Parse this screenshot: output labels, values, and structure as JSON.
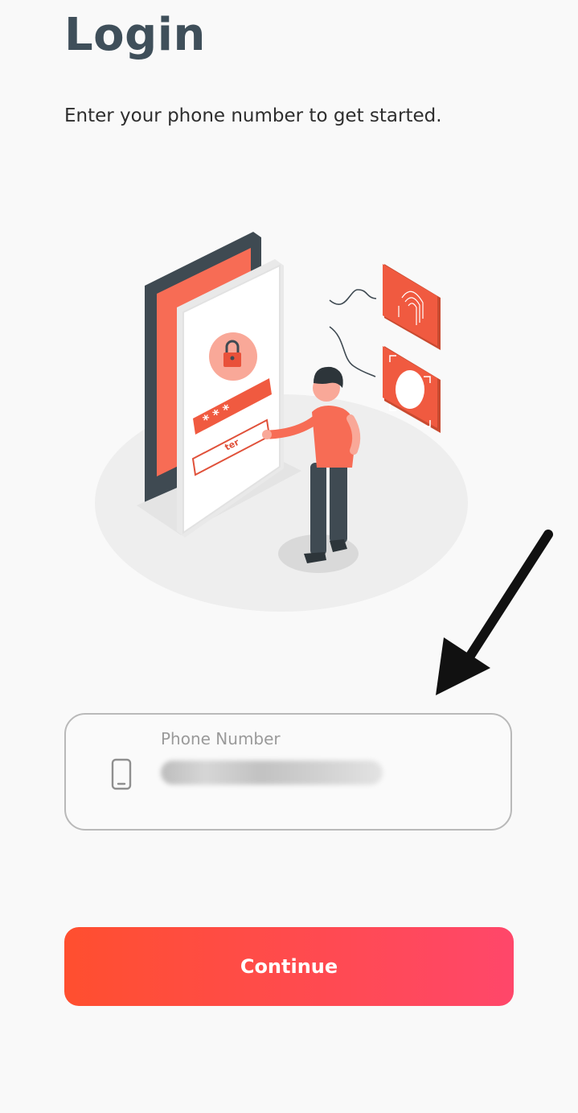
{
  "header": {
    "title": "Login",
    "subtitle": "Enter your phone number to get started."
  },
  "phone_field": {
    "label": "Phone Number",
    "value": "",
    "icon": "smartphone-icon"
  },
  "continue_button": {
    "label": "Continue"
  },
  "illustration": {
    "icon": "login-security-illustration",
    "screen_text": "ter"
  },
  "annotation": {
    "icon": "pointer-arrow-icon"
  },
  "colors": {
    "title": "#3f4f5a",
    "accent": "#fa6650",
    "button_start": "#ff4f2f",
    "button_end": "#ff476a",
    "field_border": "#b9b9b9",
    "background": "#f9f9f9"
  }
}
